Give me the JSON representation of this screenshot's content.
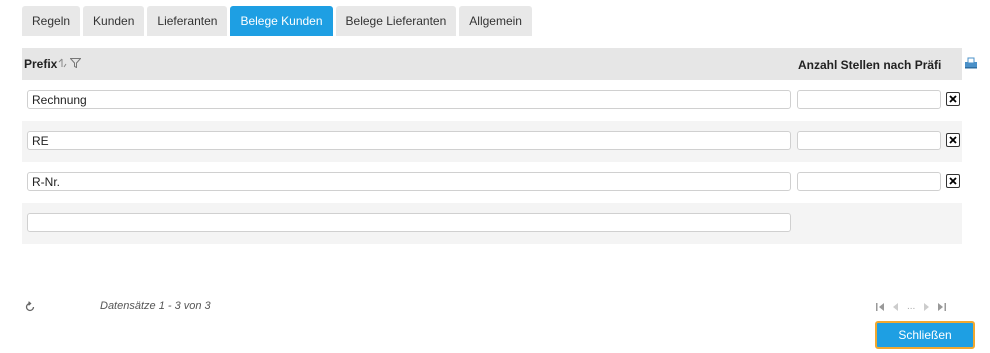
{
  "tabs": [
    {
      "label": "Regeln",
      "active": false
    },
    {
      "label": "Kunden",
      "active": false
    },
    {
      "label": "Lieferanten",
      "active": false
    },
    {
      "label": "Belege Kunden",
      "active": true
    },
    {
      "label": "Belege Lieferanten",
      "active": false
    },
    {
      "label": "Allgemein",
      "active": false
    }
  ],
  "grid": {
    "columns": {
      "prefix": "Prefix",
      "anzahl": "Anzahl Stellen nach Präfi"
    },
    "rows": [
      {
        "prefix": "Rechnung",
        "anzahl": ""
      },
      {
        "prefix": "RE",
        "anzahl": ""
      },
      {
        "prefix": "R-Nr.",
        "anzahl": ""
      }
    ],
    "new_row": {
      "prefix": ""
    }
  },
  "footer": {
    "records_info": "Datensätze 1 - 3 von 3",
    "pager_ellipsis": "..."
  },
  "close_label": "Schließen",
  "colors": {
    "accent": "#1e9fe3",
    "button_focus_border": "#f0a830"
  },
  "icons": {
    "sort": "sort-icon",
    "filter": "filter-icon",
    "export": "export-icon",
    "delete": "delete-x-icon",
    "refresh": "refresh-icon"
  }
}
